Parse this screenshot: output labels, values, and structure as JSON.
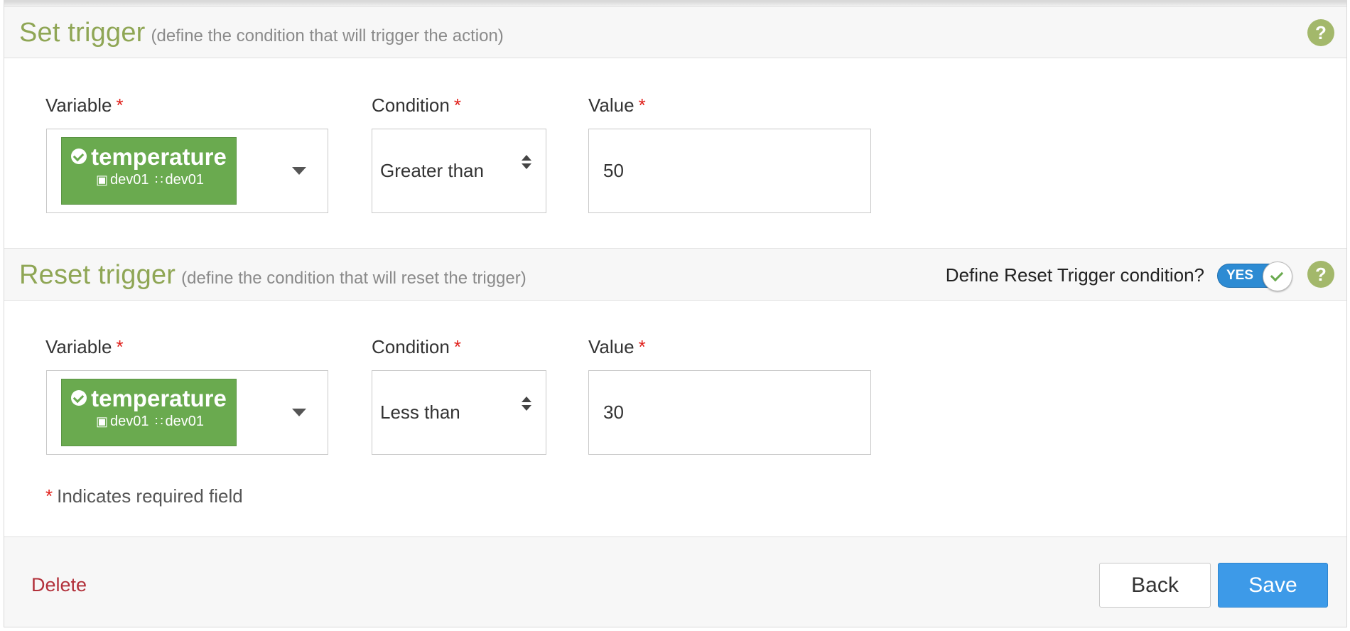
{
  "set_trigger": {
    "title": "Set trigger",
    "subtitle": "(define the condition that will trigger the action)",
    "help": "?",
    "variable_label": "Variable",
    "condition_label": "Condition",
    "value_label": "Value",
    "required_mark": "*",
    "variable": {
      "name": "temperature",
      "device": "dev01",
      "source": "dev01"
    },
    "condition": "Greater than",
    "value": "50"
  },
  "reset_trigger": {
    "title": "Reset trigger",
    "subtitle": "(define the condition that will reset the trigger)",
    "help": "?",
    "toggle_label": "Define Reset Trigger condition?",
    "toggle_state": "YES",
    "variable_label": "Variable",
    "condition_label": "Condition",
    "value_label": "Value",
    "required_mark": "*",
    "variable": {
      "name": "temperature",
      "device": "dev01",
      "source": "dev01"
    },
    "condition": "Less than",
    "value": "30"
  },
  "required_note": {
    "mark": "*",
    "text": "Indicates required field"
  },
  "footer": {
    "delete_label": "Delete",
    "back_label": "Back",
    "save_label": "Save"
  },
  "icons": [
    "check-circle-icon",
    "device-icon",
    "feed-icon",
    "dropdown-caret-icon",
    "sort-arrows-icon",
    "help-icon",
    "toggle-check-icon"
  ],
  "colors": {
    "accent_green": "#8fa655",
    "chip_green": "#6aaa4f",
    "save_blue": "#3d9ae8",
    "toggle_blue": "#2d8bd3",
    "delete_red": "#b2303a",
    "required_red": "#e0201b"
  }
}
